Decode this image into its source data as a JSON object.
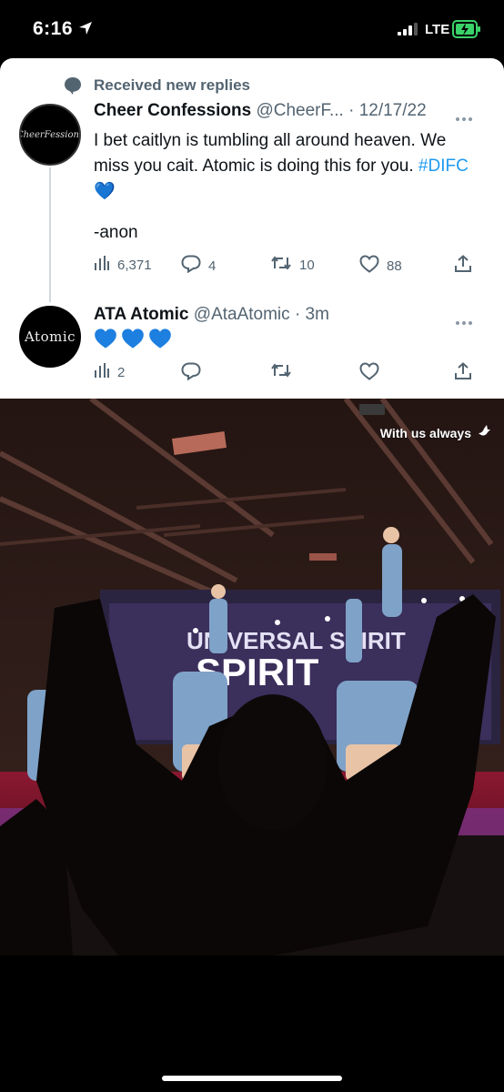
{
  "status_bar": {
    "time": "6:16",
    "network": "LTE"
  },
  "context": {
    "label": "Received new replies",
    "icon": "speech-bubble-icon"
  },
  "tweets": [
    {
      "name": "Cheer Confessions",
      "handle": "@CheerF...",
      "separator": "·",
      "time": "12/17/22",
      "avatar_text": "CheerFessions",
      "text_main": "I bet caitlyn is tumbling all around heaven. We miss you cait. Atomic is doing this for you. ",
      "hashtag": "#DIFC",
      "emoji": "💙",
      "signature": "-anon",
      "views": "6,371",
      "replies": "4",
      "retweets": "10",
      "likes": "88"
    },
    {
      "name": "ATA Atomic",
      "handle": "@AtaAtomic",
      "separator": "·",
      "time": "3m",
      "avatar_text": "Atomic",
      "views": "2"
    }
  ],
  "photo": {
    "caption": "With us always",
    "banner_text": "UNIVERSAL SPIRIT",
    "accent": "#1d9bf0",
    "heart_color": "#1d7fe0"
  }
}
